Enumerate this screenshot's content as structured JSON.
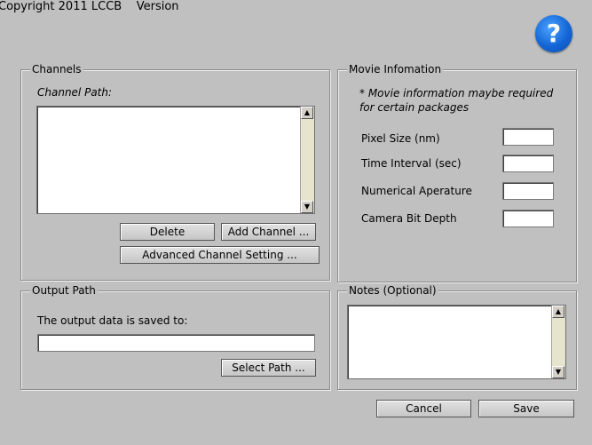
{
  "header": {
    "copyright": "Copyright 2011 LCCB    Version",
    "help_symbol": "?",
    "help_icon": "question-mark-icon"
  },
  "channels": {
    "legend": "Channels",
    "path_label": "Channel Path:",
    "delete_button": "Delete",
    "add_button": "Add Channel ...",
    "advanced_button": "Advanced Channel Setting ..."
  },
  "movie_info": {
    "legend": "Movie Infomation",
    "note_line1": "* Movie information maybe required",
    "note_line2": "for certain packages",
    "fields": [
      {
        "label": "Pixel Size (nm)",
        "value": ""
      },
      {
        "label": "Time Interval (sec)",
        "value": ""
      },
      {
        "label": "Numerical Aperature",
        "value": ""
      },
      {
        "label": "Camera Bit Depth",
        "value": ""
      }
    ]
  },
  "output": {
    "legend": "Output Path",
    "saved_label": "The output data is saved to:",
    "path_value": "",
    "select_button": "Select Path ..."
  },
  "notes": {
    "legend": "Notes (Optional)",
    "value": ""
  },
  "footer": {
    "cancel_button": "Cancel",
    "save_button": "Save"
  },
  "scroll_glyphs": {
    "up": "▲",
    "down": "▼"
  },
  "colors": {
    "background": "#c0c0c0",
    "help_blue": "#1466d6",
    "scroll_track": "#e6e4cc"
  }
}
